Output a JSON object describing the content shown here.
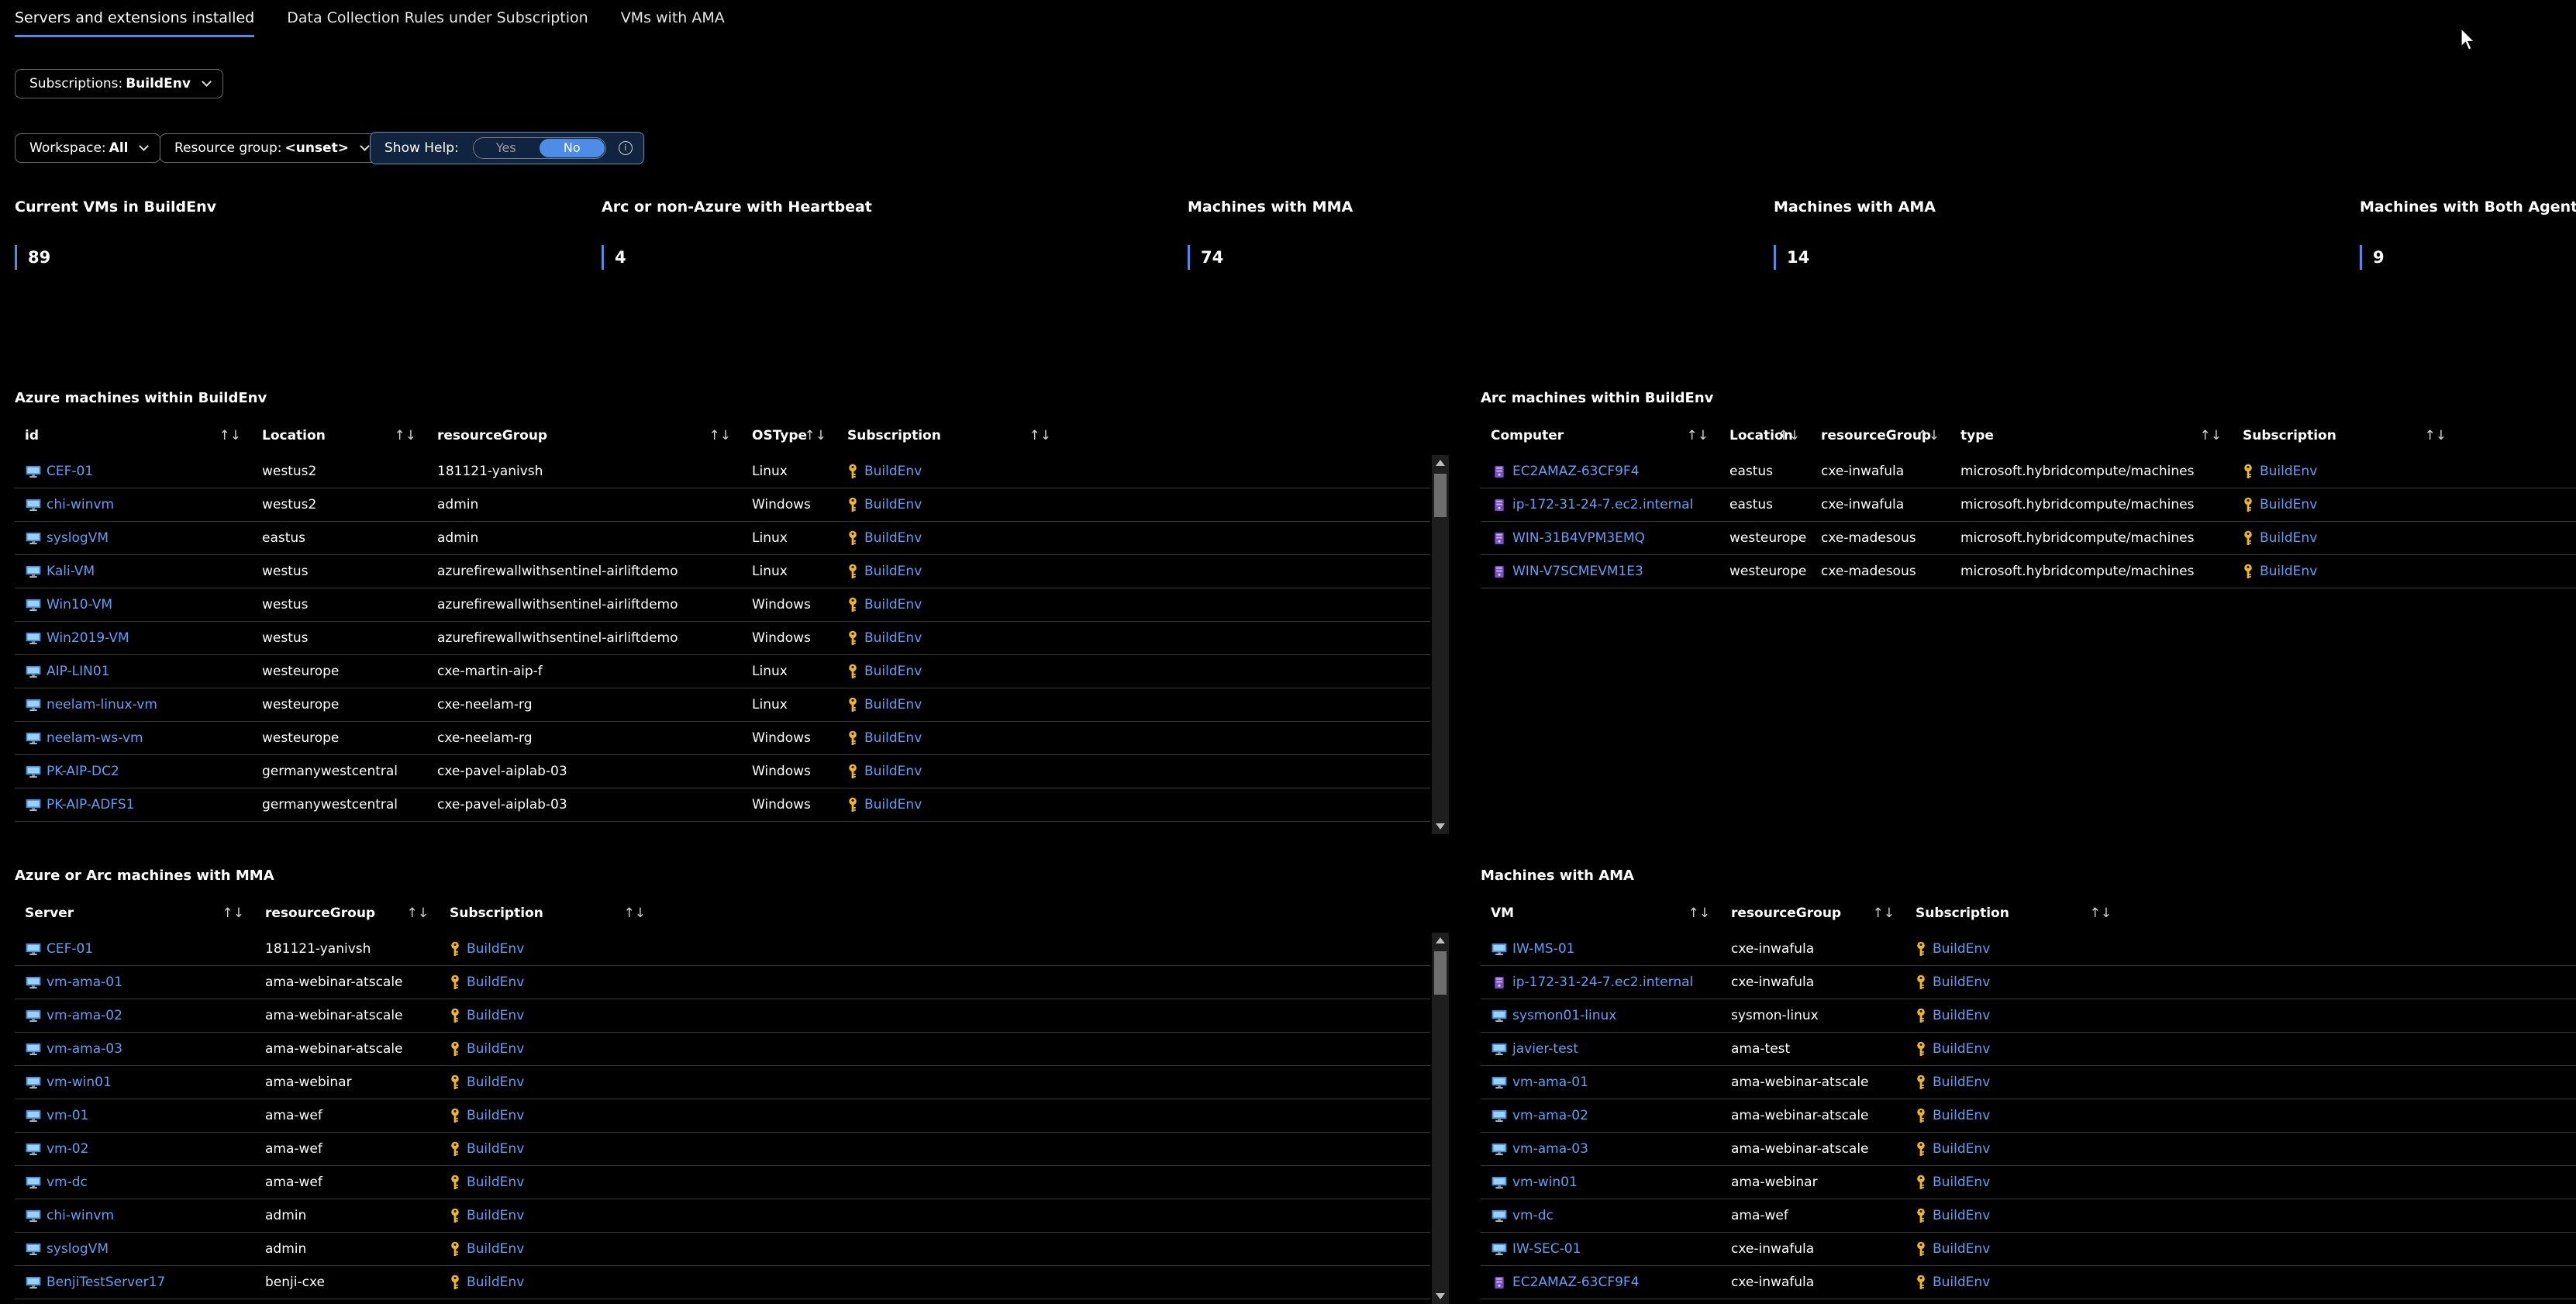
{
  "tabs": [
    {
      "label": "Servers and extensions installed",
      "active": true
    },
    {
      "label": "Data Collection Rules under Subscription",
      "active": false
    },
    {
      "label": "VMs with AMA",
      "active": false
    }
  ],
  "filters": {
    "subscriptions": {
      "label": "Subscriptions:",
      "value": "BuildEnv"
    },
    "workspace": {
      "label": "Workspace:",
      "value": "All"
    },
    "resource_group": {
      "label": "Resource group:",
      "value": "<unset>"
    },
    "show_help": {
      "label": "Show Help:",
      "yes": "Yes",
      "no": "No",
      "selected": "No"
    }
  },
  "tiles": [
    {
      "title": "Current VMs in BuildEnv",
      "value": "89"
    },
    {
      "title": "Arc or non-Azure with Heartbeat",
      "value": "4"
    },
    {
      "title": "Machines with MMA",
      "value": "74"
    },
    {
      "title": "Machines with AMA",
      "value": "14"
    },
    {
      "title": "Machines with Both Agents",
      "value": "9"
    }
  ],
  "grids": {
    "azure": {
      "title": "Azure machines within BuildEnv",
      "columns": [
        "id",
        "Location",
        "resourceGroup",
        "OSType",
        "Subscription"
      ],
      "rows": [
        [
          "CEF-01",
          "westus2",
          "181121-yanivsh",
          "Linux",
          "BuildEnv"
        ],
        [
          "chi-winvm",
          "westus2",
          "admin",
          "Windows",
          "BuildEnv"
        ],
        [
          "syslogVM",
          "eastus",
          "admin",
          "Linux",
          "BuildEnv"
        ],
        [
          "Kali-VM",
          "westus",
          "azurefirewallwithsentinel-airliftdemo",
          "Linux",
          "BuildEnv"
        ],
        [
          "Win10-VM",
          "westus",
          "azurefirewallwithsentinel-airliftdemo",
          "Windows",
          "BuildEnv"
        ],
        [
          "Win2019-VM",
          "westus",
          "azurefirewallwithsentinel-airliftdemo",
          "Windows",
          "BuildEnv"
        ],
        [
          "AIP-LIN01",
          "westeurope",
          "cxe-martin-aip-f",
          "Linux",
          "BuildEnv"
        ],
        [
          "neelam-linux-vm",
          "westeurope",
          "cxe-neelam-rg",
          "Linux",
          "BuildEnv"
        ],
        [
          "neelam-ws-vm",
          "westeurope",
          "cxe-neelam-rg",
          "Windows",
          "BuildEnv"
        ],
        [
          "PK-AIP-DC2",
          "germanywestcentral",
          "cxe-pavel-aiplab-03",
          "Windows",
          "BuildEnv"
        ],
        [
          "PK-AIP-ADFS1",
          "germanywestcentral",
          "cxe-pavel-aiplab-03",
          "Windows",
          "BuildEnv"
        ]
      ]
    },
    "arc": {
      "title": "Arc machines within BuildEnv",
      "columns": [
        "Computer",
        "Location",
        "resourceGroup",
        "type",
        "Subscription"
      ],
      "rows": [
        [
          "EC2AMAZ-63CF9F4",
          "eastus",
          "cxe-inwafula",
          "microsoft.hybridcompute/machines",
          "BuildEnv"
        ],
        [
          "ip-172-31-24-7.ec2.internal",
          "eastus",
          "cxe-inwafula",
          "microsoft.hybridcompute/machines",
          "BuildEnv"
        ],
        [
          "WIN-31B4VPM3EMQ",
          "westeurope",
          "cxe-madesous",
          "microsoft.hybridcompute/machines",
          "BuildEnv"
        ],
        [
          "WIN-V7SCMEVM1E3",
          "westeurope",
          "cxe-madesous",
          "microsoft.hybridcompute/machines",
          "BuildEnv"
        ]
      ]
    },
    "mma": {
      "title": "Azure or Arc machines with MMA",
      "columns": [
        "Server",
        "resourceGroup",
        "Subscription"
      ],
      "rows": [
        [
          "CEF-01",
          "181121-yanivsh",
          "BuildEnv"
        ],
        [
          "vm-ama-01",
          "ama-webinar-atscale",
          "BuildEnv"
        ],
        [
          "vm-ama-02",
          "ama-webinar-atscale",
          "BuildEnv"
        ],
        [
          "vm-ama-03",
          "ama-webinar-atscale",
          "BuildEnv"
        ],
        [
          "vm-win01",
          "ama-webinar",
          "BuildEnv"
        ],
        [
          "vm-01",
          "ama-wef",
          "BuildEnv"
        ],
        [
          "vm-02",
          "ama-wef",
          "BuildEnv"
        ],
        [
          "vm-dc",
          "ama-wef",
          "BuildEnv"
        ],
        [
          "chi-winvm",
          "admin",
          "BuildEnv"
        ],
        [
          "syslogVM",
          "admin",
          "BuildEnv"
        ],
        [
          "BenjiTestServer17",
          "benji-cxe",
          "BuildEnv"
        ]
      ]
    },
    "ama": {
      "title": "Machines with AMA",
      "columns": [
        "VM",
        "resourceGroup",
        "Subscription"
      ],
      "rows": [
        [
          "IW-MS-01",
          "cxe-inwafula",
          "BuildEnv"
        ],
        [
          "ip-172-31-24-7.ec2.internal",
          "cxe-inwafula",
          "BuildEnv"
        ],
        [
          "sysmon01-linux",
          "sysmon-linux",
          "BuildEnv"
        ],
        [
          "javier-test",
          "ama-test",
          "BuildEnv"
        ],
        [
          "vm-ama-01",
          "ama-webinar-atscale",
          "BuildEnv"
        ],
        [
          "vm-ama-02",
          "ama-webinar-atscale",
          "BuildEnv"
        ],
        [
          "vm-ama-03",
          "ama-webinar-atscale",
          "BuildEnv"
        ],
        [
          "vm-win01",
          "ama-webinar",
          "BuildEnv"
        ],
        [
          "vm-dc",
          "ama-wef",
          "BuildEnv"
        ],
        [
          "IW-SEC-01",
          "cxe-inwafula",
          "BuildEnv"
        ],
        [
          "EC2AMAZ-63CF9F4",
          "cxe-inwafula",
          "BuildEnv"
        ]
      ]
    }
  },
  "colors": {
    "accent": "#4d8de8",
    "link": "#5da0f5",
    "background": "#000000",
    "key": "#f2b810"
  },
  "icons": {
    "vm": "virtual-machine-icon",
    "arc": "arc-server-icon",
    "subscription": "key-icon",
    "sort": "sort-arrows-icon"
  }
}
